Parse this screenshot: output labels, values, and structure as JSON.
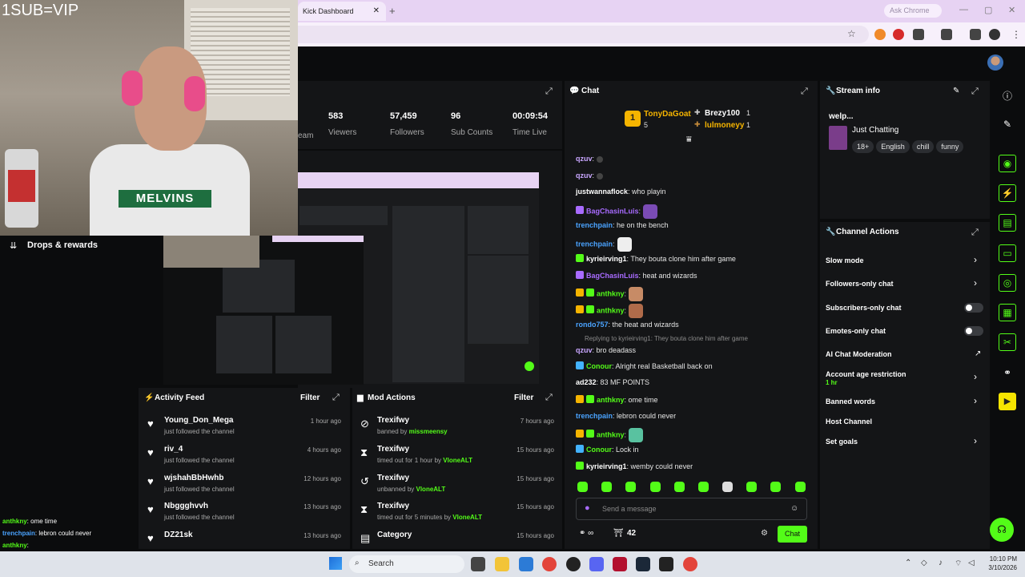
{
  "browser": {
    "tab_title": "Kick Dashboard",
    "close_tab": "✕",
    "new_tab": "+",
    "ask_chrome": "Ask Chrome"
  },
  "webcam": {
    "overlay_text": "1SUB=VIP",
    "shirt_text": "MELVINS",
    "drops_label": "Drops & rewards"
  },
  "stats": [
    {
      "value": "",
      "label": "eam"
    },
    {
      "value": "583",
      "label": "Viewers"
    },
    {
      "value": "57,459",
      "label": "Followers"
    },
    {
      "value": "96",
      "label": "Sub Counts"
    },
    {
      "value": "00:09:54",
      "label": "Time Live"
    }
  ],
  "chat": {
    "title": "Chat",
    "leaderboard": {
      "first": {
        "rank": "1",
        "name": "TonyDaGoat",
        "count": "5"
      },
      "second": {
        "name": "Brezy100",
        "count": "1"
      },
      "third": {
        "name": "lulmoneyy",
        "count": "1"
      }
    },
    "messages": [
      {
        "user": "qzuv",
        "text": ":",
        "color": "#c9a6ff"
      },
      {
        "user": "qzuv",
        "text": ":",
        "color": "#c9a6ff"
      },
      {
        "user": "justwannaflock",
        "text": ": who playin",
        "color": "#ffffff"
      },
      {
        "user": "BagChasinLuis",
        "text": ":",
        "color": "#a86bff"
      },
      {
        "user": "trenchpain",
        "text": ": he on the bench",
        "color": "#4aa3ff"
      },
      {
        "user": "trenchpain",
        "text": ":",
        "color": "#4aa3ff"
      },
      {
        "user": "kyrieirving1",
        "text": ": They bouta clone him after game",
        "color": "#ffffff"
      },
      {
        "user": "BagChasinLuis",
        "text": ": heat and wizards",
        "color": "#a86bff"
      },
      {
        "user": "anthkny",
        "text": ":",
        "color": "#53fc18"
      },
      {
        "user": "anthkny",
        "text": ":",
        "color": "#53fc18"
      },
      {
        "user": "rondo757",
        "text": ": the heat and wizards",
        "color": "#4aa3ff"
      },
      {
        "user": "qzuv",
        "text": ": bro deadass",
        "color": "#c9a6ff"
      },
      {
        "user": "Conour",
        "text": ": Alright real Basketball back on",
        "color": "#53fc18"
      },
      {
        "user": "ad232",
        "text": ": 83 MF POINTS",
        "color": "#ffffff"
      },
      {
        "user": "anthkny",
        "text": ": ome time",
        "color": "#53fc18"
      },
      {
        "user": "trenchpain",
        "text": ": lebron could never",
        "color": "#4aa3ff"
      },
      {
        "user": "anthkny",
        "text": ":",
        "color": "#53fc18"
      },
      {
        "user": "Conour",
        "text": ": Lock in",
        "color": "#53fc18"
      },
      {
        "user": "kyrieirving1",
        "text": ": wemby could never",
        "color": "#ffffff"
      }
    ],
    "reply_context": "Replying to kyrieirving1: They bouta clone him after game",
    "input_placeholder": "Send a message",
    "viewer_count": "42",
    "chat_button": "Chat"
  },
  "stream_info": {
    "title": "Stream info",
    "stream_title": "welp...",
    "category": "Just Chatting",
    "tags": [
      "18+",
      "English",
      "chill",
      "funny"
    ]
  },
  "channel_actions": {
    "title": "Channel Actions",
    "items": [
      {
        "label": "Slow mode",
        "control": "chevron"
      },
      {
        "label": "Followers-only chat",
        "control": "chevron"
      },
      {
        "label": "Subscribers-only chat",
        "control": "toggle",
        "enabled": false
      },
      {
        "label": "Emotes-only chat",
        "control": "toggle",
        "enabled": false
      },
      {
        "label": "AI Chat Moderation",
        "control": "external"
      },
      {
        "label": "Account age restriction",
        "sub": "1 hr",
        "control": "chevron"
      },
      {
        "label": "Banned words",
        "control": "chevron"
      },
      {
        "label": "Host Channel",
        "control": "none"
      },
      {
        "label": "Set goals",
        "control": "chevron"
      }
    ]
  },
  "activity_feed": {
    "title": "Activity Feed",
    "filter": "Filter",
    "items": [
      {
        "name": "Young_Don_Mega",
        "sub": "just followed the channel",
        "time": "1 hour ago"
      },
      {
        "name": "riv_4",
        "sub": "just followed the channel",
        "time": "4 hours ago"
      },
      {
        "name": "wjshahBbHwhb",
        "sub": "just followed the channel",
        "time": "12 hours ago"
      },
      {
        "name": "Nbggghvvh",
        "sub": "just followed the channel",
        "time": "13 hours ago"
      },
      {
        "name": "DZ21sk",
        "sub": "just followed the channel",
        "time": "13 hours ago"
      }
    ]
  },
  "mod_actions": {
    "title": "Mod Actions",
    "filter": "Filter",
    "items": [
      {
        "name": "Trexifwy",
        "pre": "banned by ",
        "by": "missmeensy",
        "post": "",
        "time": "7 hours ago",
        "icon": "⊘"
      },
      {
        "name": "Trexifwy",
        "pre": "timed out for 1 hour by ",
        "by": "VloneALT",
        "post": "",
        "time": "15 hours ago",
        "icon": "⧗"
      },
      {
        "name": "Trexifwy",
        "pre": "unbanned by ",
        "by": "VloneALT",
        "post": "",
        "time": "15 hours ago",
        "icon": "↺"
      },
      {
        "name": "Trexifwy",
        "pre": "timed out for 5 minutes by ",
        "by": "VloneALT",
        "post": "",
        "time": "15 hours ago",
        "icon": "⧗"
      },
      {
        "name": "Category",
        "pre": "",
        "by": "",
        "post": "",
        "time": "15 hours ago",
        "icon": "▤"
      }
    ]
  },
  "overlay_chat": [
    {
      "user": "anthkny",
      "text": ": ome time"
    },
    {
      "user": "trenchpain",
      "text": ": lebron could never"
    },
    {
      "user": "anthkny",
      "text": ":"
    },
    {
      "user": "Conour",
      "text": ": Lock in"
    },
    {
      "user": "kyrieirving1",
      "text": ": wemby could never"
    }
  ],
  "taskbar": {
    "search": "Search",
    "time": "10:10 PM",
    "date": "3/10/2026"
  },
  "colors": {
    "kick_green": "#53fc18",
    "panel_bg": "#141517",
    "page_bg": "#0b0c0d"
  }
}
